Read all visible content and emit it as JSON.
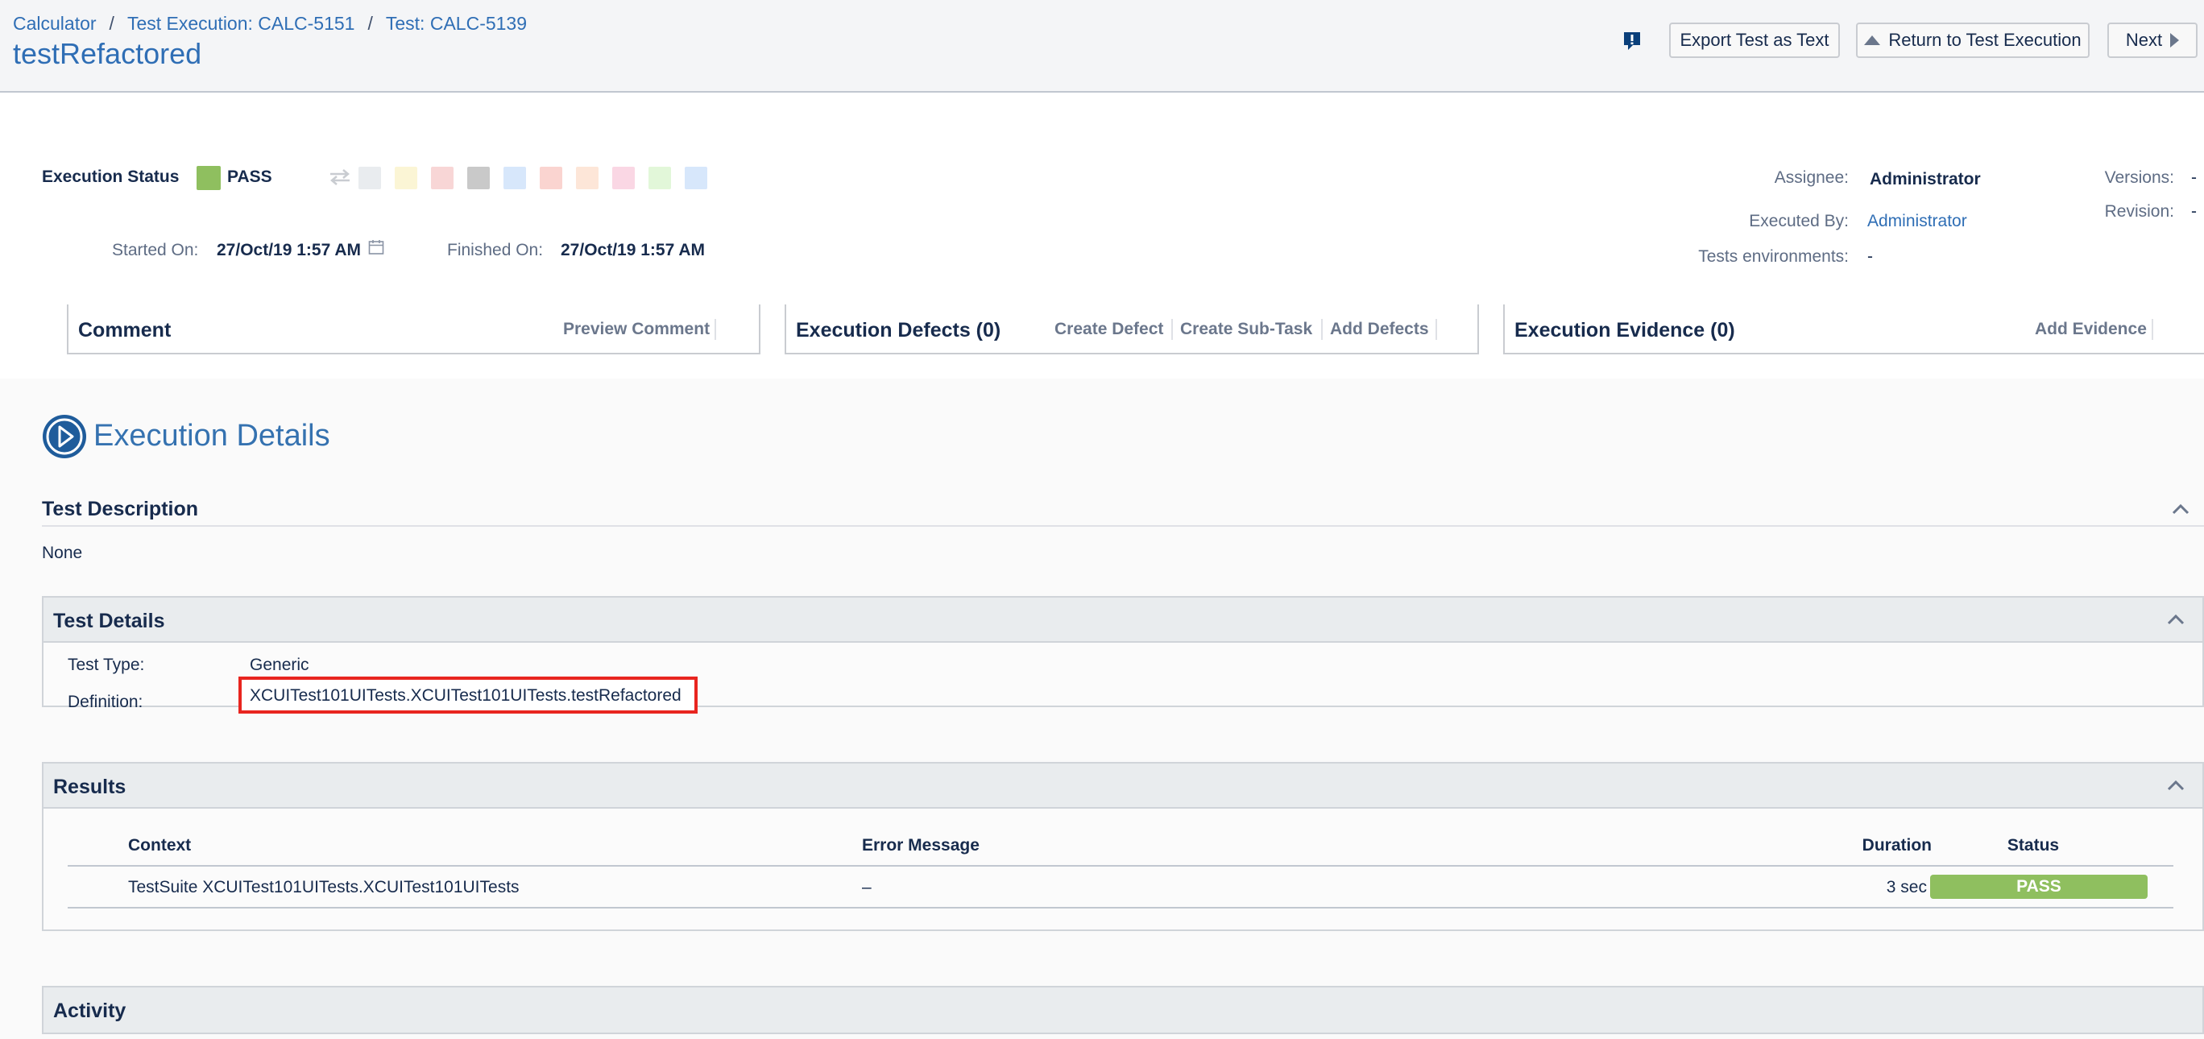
{
  "breadcrumb": {
    "items": [
      "Calculator",
      "Test Execution: CALC-5151",
      "Test: CALC-5139"
    ],
    "sep": "/"
  },
  "page_title": "testRefactored",
  "toolbar": {
    "export_label": "Export Test as Text",
    "return_label": "Return to Test Execution",
    "next_label": "Next",
    "feedback_icon": "feedback-exclamation-icon"
  },
  "execution": {
    "status_label": "Execution Status",
    "status_value": "PASS",
    "status_color": "#8fbf5f",
    "status_swatches": [
      "#e9ecef",
      "#fbf5d5",
      "#f8d6d6",
      "#c9c9c9",
      "#d7e7fb",
      "#fad4d0",
      "#fde6d8",
      "#fad7e4",
      "#e2f7d9",
      "#d7e7fb"
    ],
    "started_label": "Started On:",
    "started_value": "27/Oct/19 1:57 AM",
    "finished_label": "Finished On:",
    "finished_value": "27/Oct/19 1:57 AM"
  },
  "meta": {
    "assignee_label": "Assignee:",
    "assignee_value": "Administrator",
    "executed_by_label": "Executed By:",
    "executed_by_value": "Administrator",
    "env_label": "Tests environments:",
    "env_value": "-",
    "versions_label": "Versions:",
    "versions_value": "-",
    "revision_label": "Revision:",
    "revision_value": "-"
  },
  "panels": {
    "comment": {
      "title": "Comment",
      "actions": [
        "Preview Comment"
      ]
    },
    "defects": {
      "title": "Execution Defects (0)",
      "actions": [
        "Create Defect",
        "Create Sub-Task",
        "Add Defects"
      ]
    },
    "evidence": {
      "title": "Execution Evidence (0)",
      "actions": [
        "Add Evidence"
      ]
    }
  },
  "details": {
    "heading": "Execution Details",
    "test_description": {
      "title": "Test Description",
      "value": "None"
    },
    "test_details": {
      "title": "Test Details",
      "type_label": "Test Type:",
      "type_value": "Generic",
      "definition_label": "Definition:",
      "definition_value": "XCUITest101UITests.XCUITest101UITests.testRefactored",
      "highlight_color": "#e8251f"
    },
    "results": {
      "title": "Results",
      "columns": [
        "Context",
        "Error Message",
        "Duration",
        "Status"
      ],
      "rows": [
        {
          "context": "TestSuite XCUITest101UITests.XCUITest101UITests",
          "error": "–",
          "duration": "3 sec",
          "status": "PASS"
        }
      ]
    },
    "activity": {
      "title": "Activity"
    }
  }
}
